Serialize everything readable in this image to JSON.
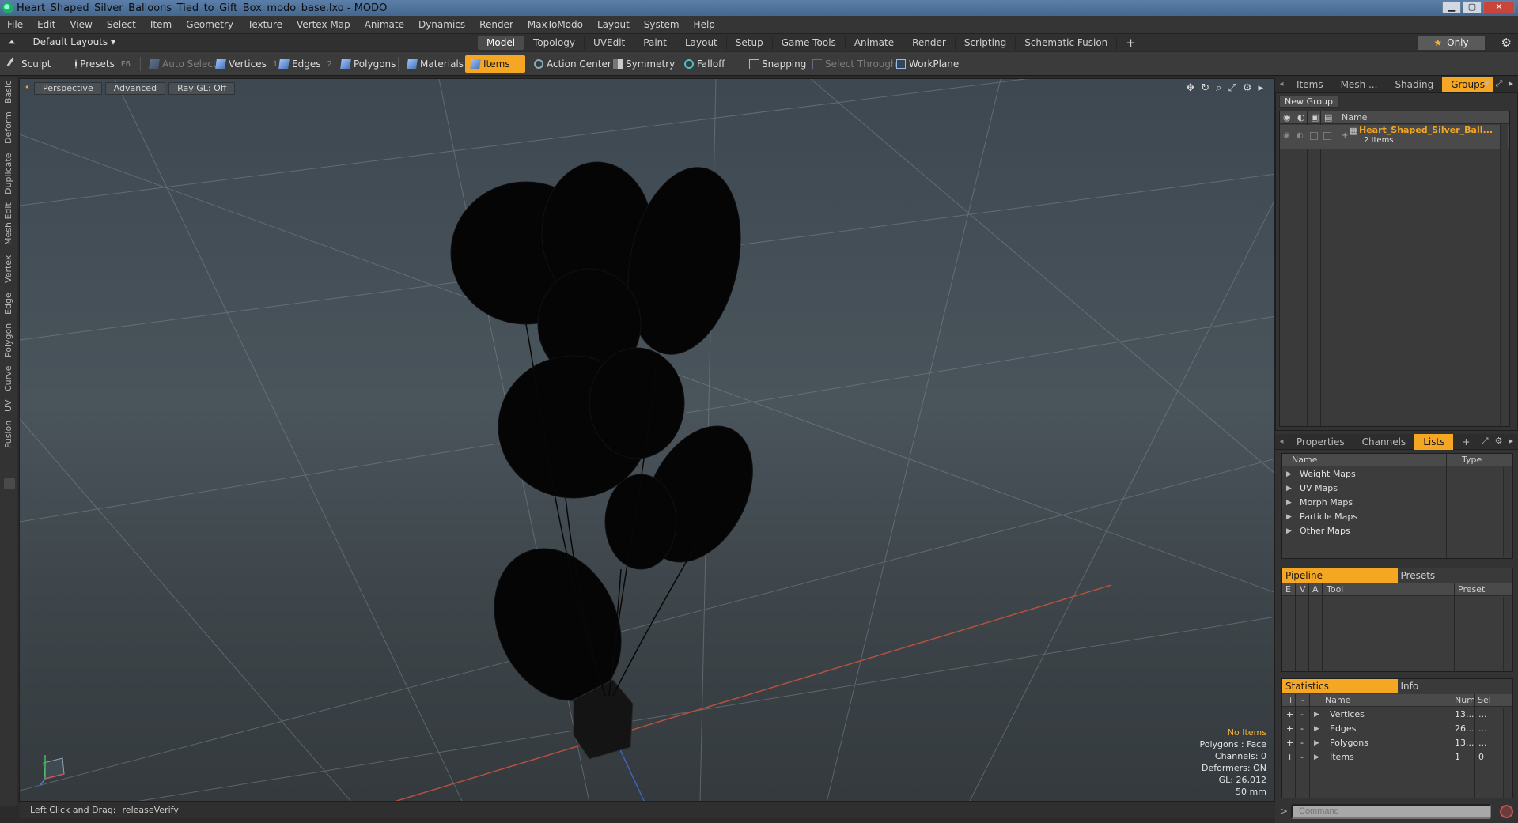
{
  "window": {
    "title": "Heart_Shaped_Silver_Balloons_Tied_to_Gift_Box_modo_base.lxo - MODO",
    "controls": [
      "▁",
      "▢",
      "✕"
    ]
  },
  "menu": [
    "File",
    "Edit",
    "View",
    "Select",
    "Item",
    "Geometry",
    "Texture",
    "Vertex Map",
    "Animate",
    "Dynamics",
    "Render",
    "MaxToModo",
    "Layout",
    "System",
    "Help"
  ],
  "layoutbar": {
    "layouts_label": "Default Layouts ▾",
    "tabs": [
      "Model",
      "Topology",
      "UVEdit",
      "Paint",
      "Layout",
      "Setup",
      "Game Tools",
      "Animate",
      "Render",
      "Scripting",
      "Schematic Fusion"
    ],
    "active_tab": "Model",
    "plus": "+",
    "only_label": "Only"
  },
  "toolbar": {
    "sculpt": "Sculpt",
    "presets": "Presets",
    "presets_key": "F6",
    "auto_select": "Auto Select",
    "vertices": "Vertices",
    "vertices_key": "1",
    "edges": "Edges",
    "edges_key": "2",
    "polygons": "Polygons",
    "materials": "Materials",
    "items": "Items",
    "action_center": "Action Center",
    "symmetry": "Symmetry",
    "falloff": "Falloff",
    "snapping": "Snapping",
    "select_through": "Select Through",
    "workplane": "WorkPlane"
  },
  "left_tabs": [
    "Basic",
    "Deform",
    "Duplicate",
    "Mesh Edit",
    "Vertex",
    "Edge",
    "Polygon",
    "Curve",
    "UV",
    "Fusion"
  ],
  "viewport": {
    "view_mode": "Perspective",
    "advanced": "Advanced",
    "raygl": "Ray GL: Off",
    "info": {
      "no_items": "No Items",
      "polygons": "Polygons : Face",
      "channels": "Channels: 0",
      "deformers": "Deformers: ON",
      "gl": "GL: 26,012",
      "units": "50 mm"
    }
  },
  "statusbar": {
    "hint": "Left Click and Drag:",
    "action": "releaseVerify"
  },
  "groups_panel": {
    "tabs": [
      "Items",
      "Mesh ...",
      "Shading",
      "Groups"
    ],
    "active_tab": "Groups",
    "new_group": "New Group",
    "name_header": "Name",
    "group_name": "Heart_Shaped_Silver_Ball...",
    "group_count": "2 Items"
  },
  "lists_panel": {
    "tabs": [
      "Properties",
      "Channels",
      "Lists"
    ],
    "active_tab": "Lists",
    "headers": {
      "name": "Name",
      "type": "Type"
    },
    "items": [
      "Weight Maps",
      "UV Maps",
      "Morph Maps",
      "Particle Maps",
      "Other Maps"
    ]
  },
  "pipeline_panel": {
    "tabs": [
      "Pipeline",
      "Presets"
    ],
    "headers": {
      "e": "E",
      "v": "V",
      "a": "A",
      "tool": "Tool",
      "preset": "Preset"
    }
  },
  "statistics_panel": {
    "tabs": [
      "Statistics",
      "Info"
    ],
    "headers": {
      "plus": "+",
      "minus": "-",
      "name": "Name",
      "num": "Num",
      "sel": "Sel"
    },
    "rows": [
      {
        "name": "Vertices",
        "num": "13...",
        "sel": "..."
      },
      {
        "name": "Edges",
        "num": "26...",
        "sel": "..."
      },
      {
        "name": "Polygons",
        "num": "13...",
        "sel": "..."
      },
      {
        "name": "Items",
        "num": "1",
        "sel": "0"
      }
    ]
  },
  "command": {
    "placeholder": "Command",
    "prompt": ">"
  },
  "colors": {
    "accent": "#f5a623",
    "panel_bg": "#3c3c3c",
    "viewport_top": "#3d4851",
    "group_name": "#f5a623"
  }
}
